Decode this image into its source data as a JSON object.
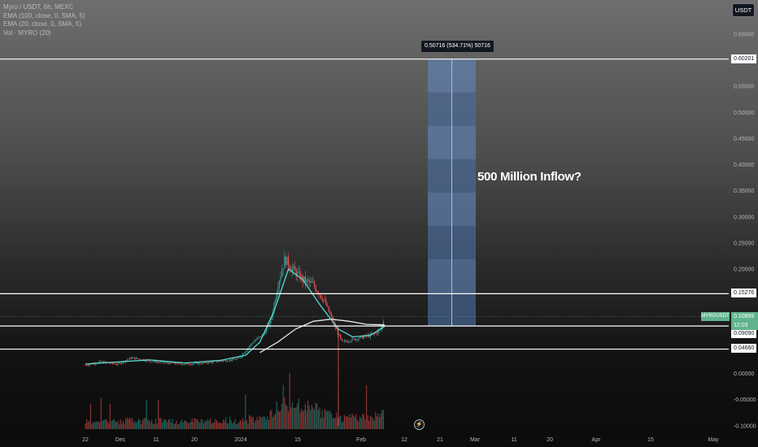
{
  "legend": {
    "symbol_line": "Myro / USDT, 6h, MEXC",
    "ema1": "EMA (100, close, 0, SMA, 5)",
    "ema2": "EMA (20, close, 0, SMA, 5)",
    "volume": "Vol · MYRO (20)"
  },
  "currency_button": "USDT",
  "annotation": "500 Million Inflow?",
  "measure_label": "0.50716 (534.71%) 50716",
  "horizontal_line_labels": [
    "0.60201",
    "0.15276",
    "0.09090",
    "0.04660"
  ],
  "symbol_tag": "MYROUSDT",
  "current_price": "0.10899",
  "countdown": "12:03",
  "colors": {
    "up": "#26a69a",
    "down": "#ef5350",
    "ema_fast": "#5dd6d0",
    "ema_slow": "#e6e6e6",
    "measure_box": "#5b7fb5",
    "hline": "#ffffff"
  },
  "chart_data": {
    "type": "line",
    "title": "Myro / USDT, 6h, MEXC",
    "price_axis_ticks": [
      "0.65000",
      "0.60201",
      "0.55000",
      "0.50000",
      "0.45000",
      "0.40000",
      "0.35000",
      "0.30000",
      "0.25000",
      "0.20000",
      "0.15276",
      "0.10899",
      "0.09090",
      "0.04660",
      "0.00000",
      "-0.05000",
      "-0.10000"
    ],
    "time_axis_ticks": [
      "22",
      "Dec",
      "11",
      "20",
      "2024",
      "15",
      "Feb",
      "12",
      "21",
      "Mar",
      "11",
      "20",
      "Apr",
      "15",
      "May"
    ],
    "horizontal_levels": [
      0.60201,
      0.15276,
      0.0909,
      0.0466
    ],
    "current_price": 0.10899,
    "measure": {
      "from": 0.0909,
      "to": 0.60201,
      "change": 0.50716,
      "percent": 534.71
    },
    "price_series": {
      "name": "Myro / USDT",
      "x": [
        "2023-11-22",
        "2023-11-26",
        "2023-12-01",
        "2023-12-05",
        "2023-12-10",
        "2023-12-15",
        "2023-12-20",
        "2023-12-25",
        "2023-12-30",
        "2024-01-04",
        "2024-01-08",
        "2024-01-11",
        "2024-01-13",
        "2024-01-15",
        "2024-01-17",
        "2024-01-19",
        "2024-01-22",
        "2024-01-25",
        "2024-01-28",
        "2024-01-31",
        "2024-02-02",
        "2024-02-05",
        "2024-02-08",
        "2024-02-11",
        "2024-02-13",
        "2024-02-14"
      ],
      "y": [
        0.016,
        0.022,
        0.018,
        0.03,
        0.024,
        0.02,
        0.018,
        0.02,
        0.024,
        0.028,
        0.06,
        0.075,
        0.1,
        0.17,
        0.22,
        0.2,
        0.18,
        0.17,
        0.14,
        0.09,
        0.06,
        0.065,
        0.07,
        0.075,
        0.085,
        0.109
      ]
    },
    "ema_fast": {
      "name": "EMA (20, close, 0, SMA, 5)",
      "x": [
        "2023-11-22",
        "2023-12-01",
        "2023-12-10",
        "2023-12-20",
        "2023-12-30",
        "2024-01-06",
        "2024-01-10",
        "2024-01-14",
        "2024-01-18",
        "2024-01-22",
        "2024-01-27",
        "2024-02-01",
        "2024-02-05",
        "2024-02-10",
        "2024-02-14"
      ],
      "y": [
        0.018,
        0.022,
        0.026,
        0.02,
        0.025,
        0.035,
        0.06,
        0.12,
        0.2,
        0.18,
        0.13,
        0.085,
        0.07,
        0.073,
        0.09
      ]
    },
    "ema_slow": {
      "name": "EMA (100, close, 0, SMA, 5)",
      "x": [
        "2024-01-10",
        "2024-01-15",
        "2024-01-20",
        "2024-01-25",
        "2024-01-30",
        "2024-02-04",
        "2024-02-09",
        "2024-02-14"
      ],
      "y": [
        0.04,
        0.06,
        0.085,
        0.1,
        0.104,
        0.1,
        0.094,
        0.093
      ]
    },
    "grid": false,
    "legend_position": "top-left"
  }
}
